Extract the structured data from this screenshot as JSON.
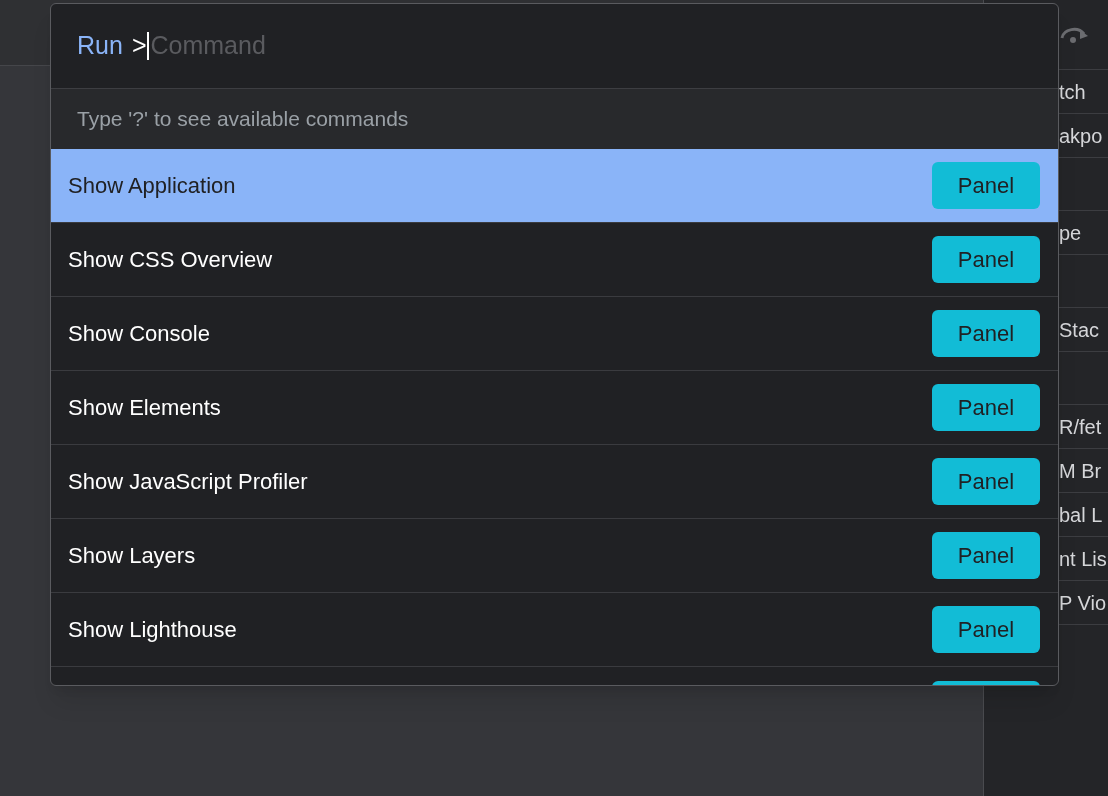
{
  "sidebar": {
    "items": [
      {
        "kind": "text",
        "label": "tch"
      },
      {
        "kind": "text",
        "label": "akpo"
      },
      {
        "kind": "blank"
      },
      {
        "kind": "text",
        "label": "pe"
      },
      {
        "kind": "blank"
      },
      {
        "kind": "text",
        "label": "Stac"
      },
      {
        "kind": "blank"
      },
      {
        "kind": "text",
        "label": "R/fet"
      },
      {
        "kind": "text",
        "label": "M Br"
      },
      {
        "kind": "text",
        "label": "bal L"
      },
      {
        "kind": "text",
        "label": "nt Lis"
      },
      {
        "kind": "text",
        "label": "P Vio"
      }
    ]
  },
  "palette": {
    "prefix": "Run",
    "prompt": ">",
    "placeholder": "Command",
    "hint": "Type '?' to see available commands",
    "overflow": true,
    "items": [
      {
        "label": "Show Application",
        "badge": "Panel",
        "selected": true
      },
      {
        "label": "Show CSS Overview",
        "badge": "Panel",
        "selected": false
      },
      {
        "label": "Show Console",
        "badge": "Panel",
        "selected": false
      },
      {
        "label": "Show Elements",
        "badge": "Panel",
        "selected": false
      },
      {
        "label": "Show JavaScript Profiler",
        "badge": "Panel",
        "selected": false
      },
      {
        "label": "Show Layers",
        "badge": "Panel",
        "selected": false
      },
      {
        "label": "Show Lighthouse",
        "badge": "Panel",
        "selected": false
      }
    ]
  }
}
